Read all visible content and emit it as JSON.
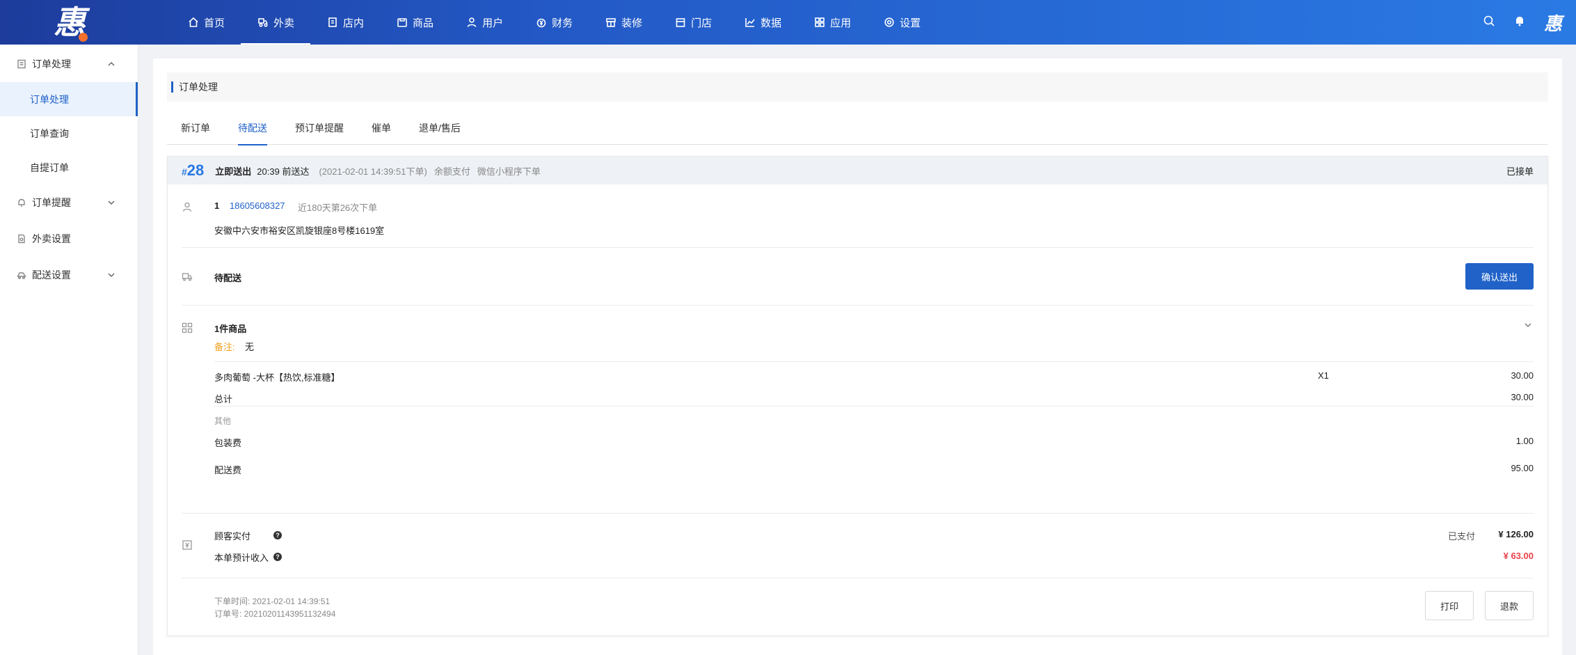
{
  "brand": {
    "logo": "惠",
    "avatar": "惠"
  },
  "nav": [
    {
      "label": "首页",
      "icon": "home-icon"
    },
    {
      "label": "外卖",
      "icon": "takeout-icon",
      "active": true
    },
    {
      "label": "店内",
      "icon": "store-in-icon"
    },
    {
      "label": "商品",
      "icon": "product-icon"
    },
    {
      "label": "用户",
      "icon": "user-icon"
    },
    {
      "label": "财务",
      "icon": "finance-icon"
    },
    {
      "label": "装修",
      "icon": "decorate-icon"
    },
    {
      "label": "门店",
      "icon": "shop-icon"
    },
    {
      "label": "数据",
      "icon": "chart-icon"
    },
    {
      "label": "应用",
      "icon": "apps-icon"
    },
    {
      "label": "设置",
      "icon": "settings-icon"
    }
  ],
  "sidebar": {
    "group1": "订单处理",
    "sub1": "订单处理",
    "sub2": "订单查询",
    "sub3": "自提订单",
    "group2": "订单提醒",
    "group3": "外卖设置",
    "group4": "配送设置"
  },
  "page_title": "订单处理",
  "tabs": [
    "新订单",
    "待配送",
    "预订单提醒",
    "催单",
    "退单/售后"
  ],
  "order": {
    "hash": "#",
    "number": "28",
    "send_type": "立即送出",
    "deadline": "20:39 前送达",
    "created": "(2021-02-01 14:39:51下单)",
    "pay_method": "余额支付",
    "channel": "微信小程序下单",
    "status": "已接单",
    "customer_name": "1",
    "phone": "18605608327",
    "history": "近180天第26次下单",
    "address": "安徽中六安市裕安区凯旋银座8号楼1619室",
    "delivery_status": "待配送",
    "confirm_button": "确认送出",
    "goods_count": "1件商品",
    "remark_label": "备注:",
    "remark_value": "无",
    "item_name": "多肉葡萄 -大杯【热饮,标准糖】",
    "item_qty": "X1",
    "item_price": "30.00",
    "subtotal_label": "总计",
    "subtotal": "30.00",
    "other_label": "其他",
    "packing_label": "包装费",
    "packing_fee": "1.00",
    "delivery_label": "配送费",
    "delivery_fee": "95.00",
    "paid_label": "顾客实付",
    "paid_status": "已支付",
    "paid_amount": "¥ 126.00",
    "income_label": "本单预计收入",
    "income_amount": "¥ 63.00",
    "order_time": "下单时间: 2021-02-01 14:39:51",
    "order_no": "订单号: 20210201143951132494",
    "print_button": "打印",
    "refund_button": "退款"
  },
  "colors": {
    "primary": "#2062c8",
    "accent_orange": "#f0a020",
    "income_red": "#e8424a"
  }
}
